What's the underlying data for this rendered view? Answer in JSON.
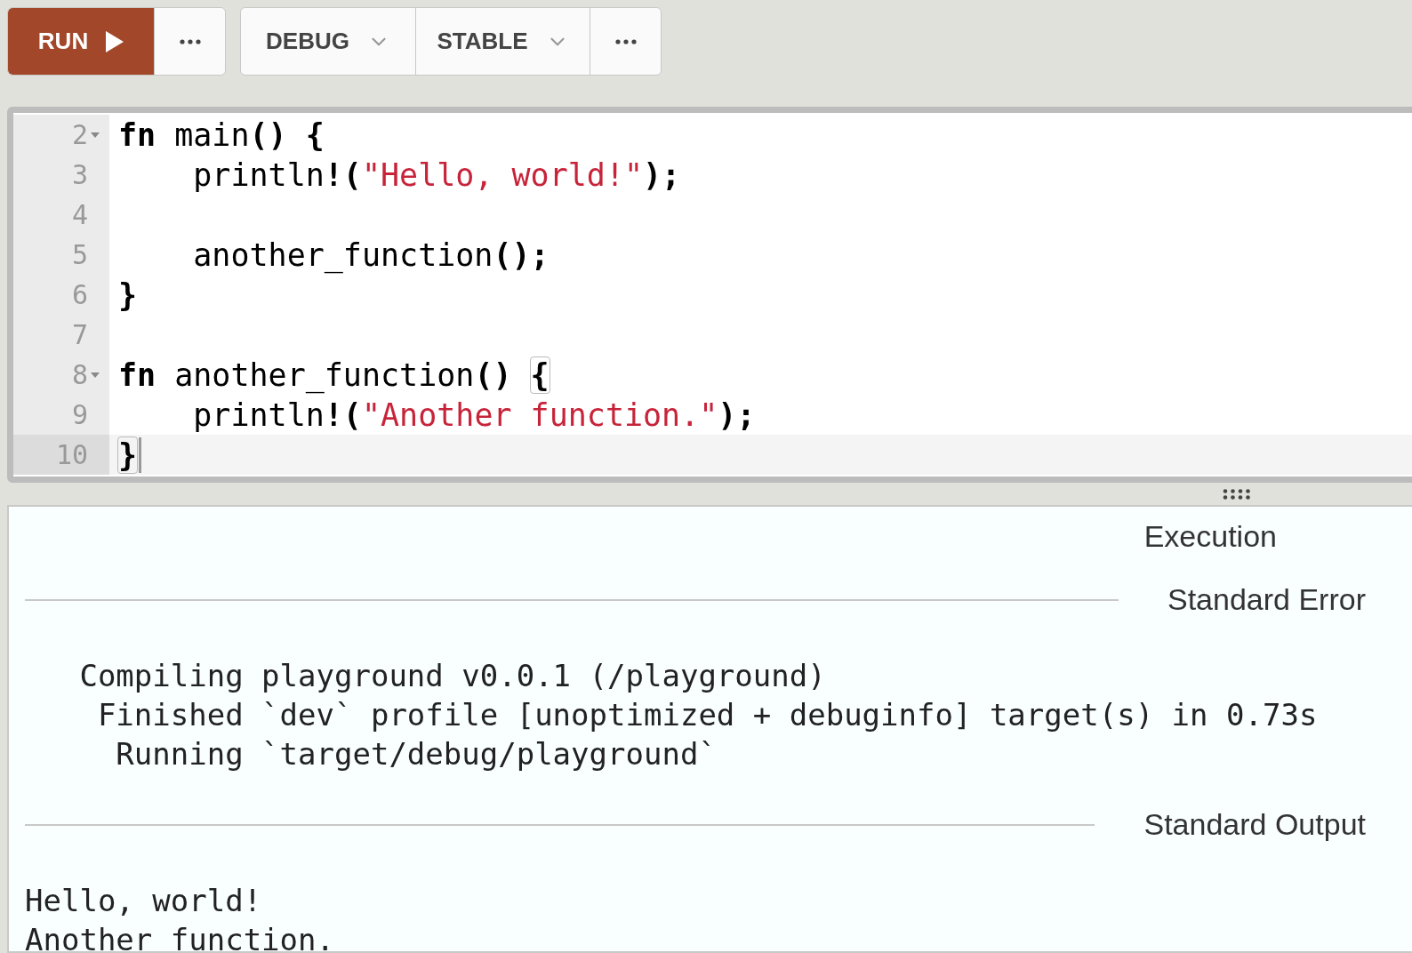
{
  "toolbar": {
    "groups": [
      [
        {
          "kind": "run",
          "label": "RUN"
        },
        {
          "kind": "more"
        }
      ],
      [
        {
          "kind": "menu",
          "label": "DEBUG"
        },
        {
          "kind": "menu",
          "label": "STABLE"
        },
        {
          "kind": "more"
        }
      ]
    ]
  },
  "editor": {
    "lines": [
      {
        "number": "2",
        "foldable": true,
        "active": false,
        "tokens": [
          {
            "text": "fn",
            "kind": "keyword"
          },
          {
            "text": " main",
            "kind": "plain"
          },
          {
            "text": "() {",
            "kind": "bold"
          }
        ]
      },
      {
        "number": "3",
        "foldable": false,
        "active": false,
        "tokens": [
          {
            "text": "    println",
            "kind": "plain"
          },
          {
            "text": "!(",
            "kind": "bold"
          },
          {
            "text": "\"Hello, world!\"",
            "kind": "string"
          },
          {
            "text": ");",
            "kind": "bold"
          }
        ]
      },
      {
        "number": "4",
        "foldable": false,
        "active": false
      },
      {
        "number": "5",
        "foldable": false,
        "active": false,
        "tokens": [
          {
            "text": "    another_function",
            "kind": "plain"
          },
          {
            "text": "();",
            "kind": "bold"
          }
        ]
      },
      {
        "number": "6",
        "foldable": false,
        "active": false,
        "tokens": [
          {
            "text": "}",
            "kind": "bold"
          }
        ]
      },
      {
        "number": "7",
        "foldable": false,
        "active": false
      },
      {
        "number": "8",
        "foldable": true,
        "active": false,
        "tokens": [
          {
            "text": "fn",
            "kind": "keyword"
          },
          {
            "text": " another_function",
            "kind": "plain"
          },
          {
            "text": "() ",
            "kind": "bold"
          },
          {
            "text": "{",
            "kind": "matched"
          }
        ]
      },
      {
        "number": "9",
        "foldable": false,
        "active": false,
        "tokens": [
          {
            "text": "    println",
            "kind": "plain"
          },
          {
            "text": "!(",
            "kind": "bold"
          },
          {
            "text": "\"Another function.\"",
            "kind": "string"
          },
          {
            "text": ");",
            "kind": "bold"
          }
        ]
      },
      {
        "number": "10",
        "foldable": false,
        "active": true,
        "tokens": [
          {
            "text": "}",
            "kind": "matched"
          }
        ]
      }
    ]
  },
  "output": {
    "sections": [
      {
        "kind": "heading",
        "title": "Execution"
      },
      {
        "kind": "stream",
        "title": "Standard Error",
        "lines": [
          "   Compiling playground v0.0.1 (/playground)",
          "    Finished `dev` profile [unoptimized + debuginfo] target(s) in 0.73s",
          "     Running `target/debug/playground`"
        ]
      },
      {
        "kind": "stream",
        "title": "Standard Output",
        "lines": [
          "Hello, world!",
          "Another function."
        ]
      }
    ]
  }
}
